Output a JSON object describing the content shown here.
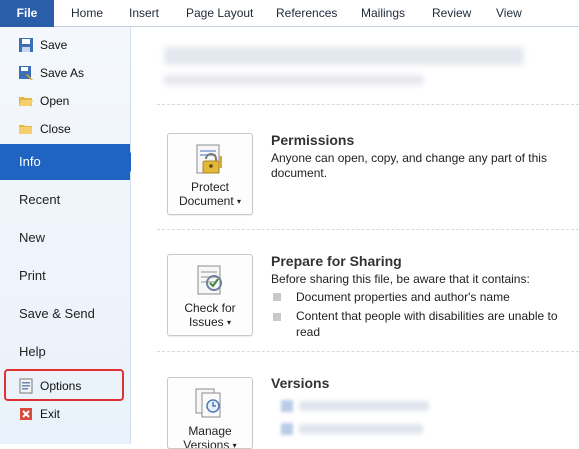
{
  "ribbon": {
    "file": "File",
    "tabs": [
      "Home",
      "Insert",
      "Page Layout",
      "References",
      "Mailings",
      "Review",
      "View"
    ]
  },
  "nav": {
    "commands": [
      {
        "label": "Save",
        "icon": "save-icon"
      },
      {
        "label": "Save As",
        "icon": "save-as-icon"
      },
      {
        "label": "Open",
        "icon": "open-folder-icon"
      },
      {
        "label": "Close",
        "icon": "close-folder-icon"
      }
    ],
    "info": "Info",
    "items": [
      "Recent",
      "New",
      "Print",
      "Save & Send",
      "Help"
    ],
    "options": "Options",
    "exit": "Exit",
    "selected_color": "#1f64c3",
    "highlight_color": "#e03030"
  },
  "main": {
    "permissions": {
      "button_line1": "Protect",
      "button_line2": "Document",
      "heading": "Permissions",
      "text": "Anyone can open, copy, and change any part of this document."
    },
    "sharing": {
      "button_line1": "Check for",
      "button_line2": "Issues",
      "heading": "Prepare for Sharing",
      "text": "Before sharing this file, be aware that it contains:",
      "bullets": [
        "Document properties and author's name",
        "Content that people with disabilities are unable to read"
      ]
    },
    "versions": {
      "button_line1": "Manage",
      "button_line2": "Versions",
      "heading": "Versions"
    }
  }
}
